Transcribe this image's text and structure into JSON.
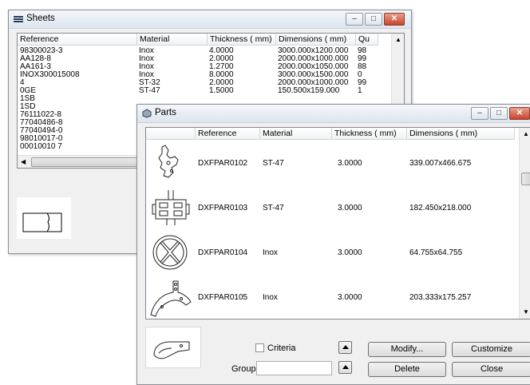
{
  "sheets": {
    "title": "Sheets",
    "columns": [
      "Reference",
      "Material",
      "Thickness ( mm)",
      "Dimensions ( mm)",
      "Qu"
    ],
    "rows": [
      [
        "98300023-3",
        "Inox",
        "4.0000",
        "3000.000x1200.000",
        "98"
      ],
      [
        "AA128-8",
        "Inox",
        "2.0000",
        "2000.000x1000.000",
        "99"
      ],
      [
        "AA161-3",
        "Inox",
        "1.2700",
        "2000.000x1050.000",
        "88"
      ],
      [
        "INOX300015008",
        "Inox",
        "8.0000",
        "3000.000x1500.000",
        "0"
      ],
      [
        "4",
        "ST-32",
        "2.0000",
        "2000.000x1000.000",
        "99"
      ],
      [
        "0GE",
        "ST-47",
        "1.5000",
        "150.500x159.000",
        "1"
      ],
      [
        "1SB",
        "",
        "",
        "",
        ""
      ],
      [
        "1SD",
        "",
        "",
        "",
        ""
      ],
      [
        "76111022-8",
        "",
        "",
        "",
        ""
      ],
      [
        "77040486-8",
        "",
        "",
        "",
        ""
      ],
      [
        "77040494-0",
        "",
        "",
        "",
        ""
      ],
      [
        "98010017-0",
        "",
        "",
        "",
        ""
      ],
      [
        "00010010 7",
        "",
        "",
        "",
        ""
      ]
    ]
  },
  "parts": {
    "title": "Parts",
    "columns": [
      "Reference",
      "Material",
      "Thickness ( mm)",
      "Dimensions ( mm)"
    ],
    "rows": [
      {
        "reference": "DXFPAR0102",
        "material": "ST-47",
        "thickness": "3.0000",
        "dimensions": "339.007x466.675",
        "icon": "bracket-part-icon"
      },
      {
        "reference": "DXFPAR0103",
        "material": "ST-47",
        "thickness": "3.0000",
        "dimensions": "182.450x218.000",
        "icon": "frame-part-icon"
      },
      {
        "reference": "DXFPAR0104",
        "material": "Inox",
        "thickness": "3.0000",
        "dimensions": "64.755x64.755",
        "icon": "round-part-icon"
      },
      {
        "reference": "DXFPAR0105",
        "material": "Inox",
        "thickness": "3.0000",
        "dimensions": "203.333x175.257",
        "icon": "arc-part-icon"
      }
    ],
    "criteria_label": "Criteria",
    "criteria_checked": false,
    "group_label": "Group",
    "group_value": "",
    "buttons": {
      "modify": "Modify...",
      "customize": "Customize",
      "delete": "Delete",
      "close": "Close"
    }
  },
  "colors": {
    "titlebar": "#dde5ef",
    "close_button": "#c8432a",
    "window_bg": "#f0f0f0"
  }
}
